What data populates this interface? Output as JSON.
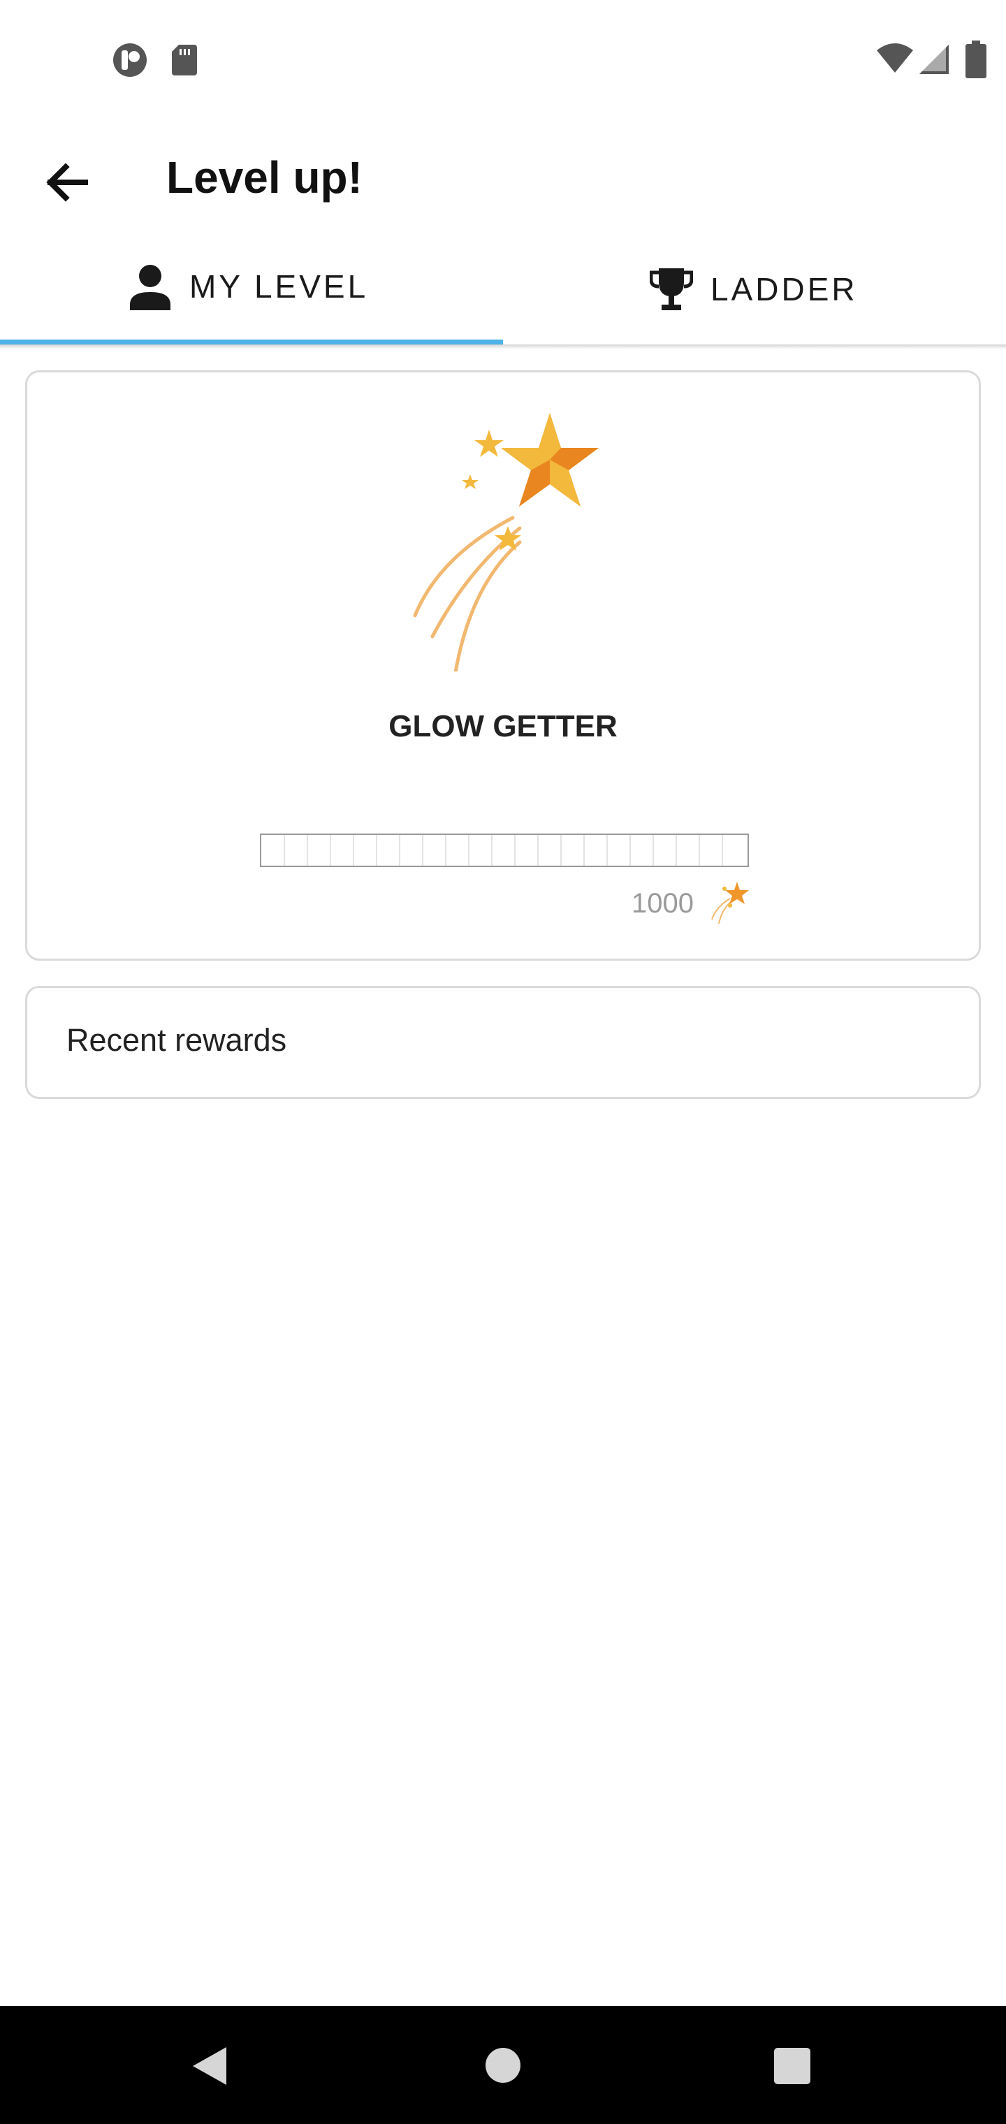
{
  "status_bar": {
    "left_icons": [
      "app-notification-icon",
      "sd-card-icon"
    ],
    "right_icons": [
      "wifi-icon",
      "signal-icon",
      "battery-icon"
    ]
  },
  "app_bar": {
    "title": "Level up!",
    "back_icon": "arrow-left-icon"
  },
  "tabs": [
    {
      "label": "MY LEVEL",
      "icon": "person-icon",
      "selected": true
    },
    {
      "label": "LADDER",
      "icon": "trophy-icon",
      "selected": false
    }
  ],
  "level_card": {
    "image": "shooting-star",
    "level_name": "GLOW GETTER",
    "progress": 0,
    "points_target": "1000",
    "points_icon": "shooting-star-icon"
  },
  "rewards_card": {
    "label": "Recent rewards"
  },
  "colors": {
    "tab_indicator": "#4db2e8",
    "star_orange": "#f0962a",
    "star_yellow": "#f3b93c",
    "trail": "#f2b870"
  },
  "nav_bar": {
    "buttons": [
      "back-nav-icon",
      "home-nav-icon",
      "recents-nav-icon"
    ]
  }
}
